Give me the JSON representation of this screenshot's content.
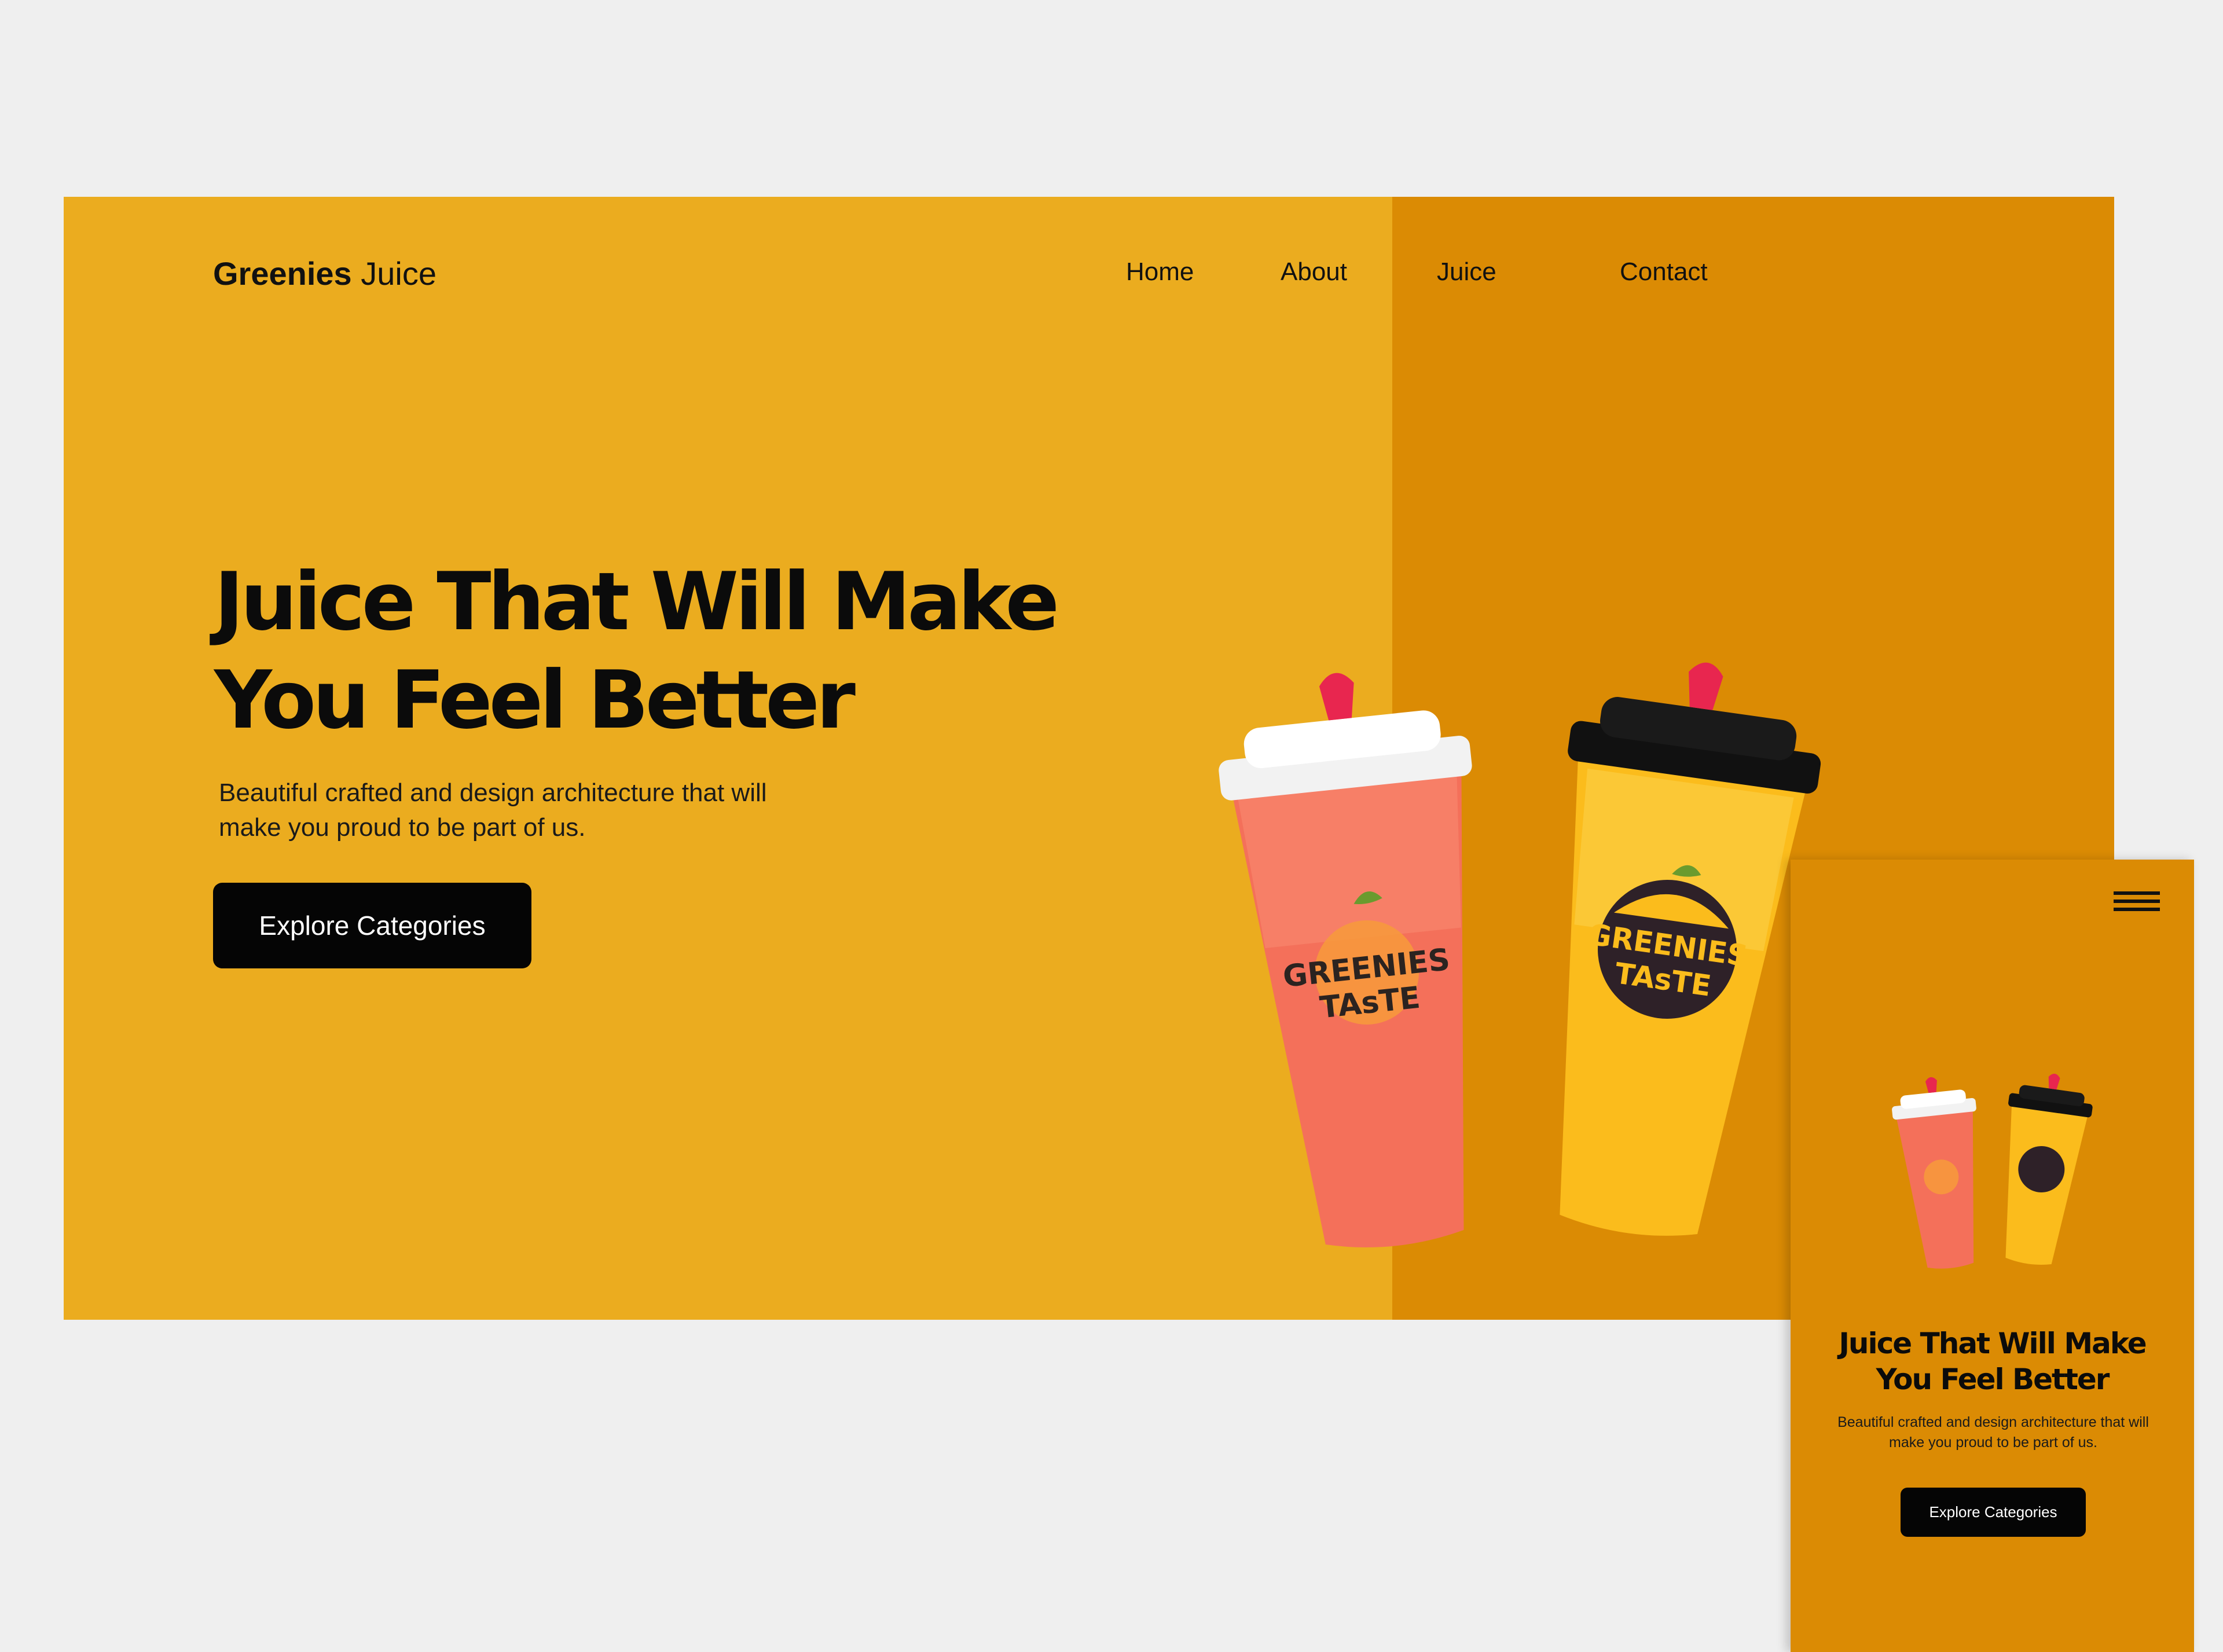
{
  "header": {
    "brand_bold": "Greenies",
    "brand_light": "Juice",
    "nav": [
      "Home",
      "About",
      "Juice",
      "Contact"
    ]
  },
  "hero": {
    "title_line1": "Juice That Will Make",
    "title_line2": "You Feel Better",
    "subtitle_line1": "Beautiful crafted and design architecture that will",
    "subtitle_line2": "make you proud to be part of us.",
    "cta": "Explore Categories",
    "cup_label_line1": "GREENIES",
    "cup_label_line2": "TAsTE"
  },
  "mobile": {
    "title_line1": "Juice That Will Make",
    "title_line2": "You Feel Better",
    "subtitle_line1": "Beautiful crafted and design architecture that will",
    "subtitle_line2": "make you proud to be part of us.",
    "cta": "Explore Categories",
    "menu_icon": "hamburger-menu-icon"
  },
  "colors": {
    "page_bg": "#efefef",
    "primary_yellow": "#ebac1f",
    "dark_orange": "#db8b04",
    "button_bg": "#050505"
  }
}
